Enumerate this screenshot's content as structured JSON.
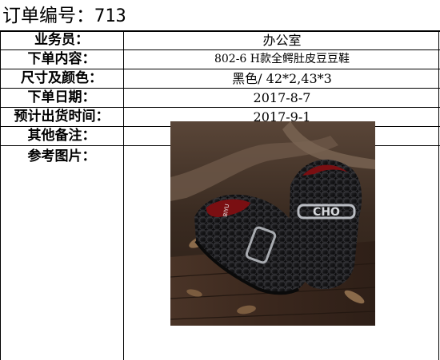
{
  "title": {
    "label": "订单编号：",
    "number": "713"
  },
  "rows": [
    {
      "label": "业务员：",
      "value": "办公室"
    },
    {
      "label": "下单内容：",
      "value": "802-6 H款全鳄肚皮豆豆鞋"
    },
    {
      "label": "尺寸及颜色：",
      "value": "黑色/ 42*2,43*3"
    },
    {
      "label": "下单日期：",
      "value": "2017-8-7"
    },
    {
      "label": "预计出货时间：",
      "value": "2017-9-1"
    },
    {
      "label": "其他备注：",
      "value": ""
    },
    {
      "label": "参考图片：",
      "value": ""
    }
  ],
  "photo": {
    "icon": "shoe-photo-icon",
    "buckle_text": "CHO",
    "insole_text": "BIYU"
  }
}
